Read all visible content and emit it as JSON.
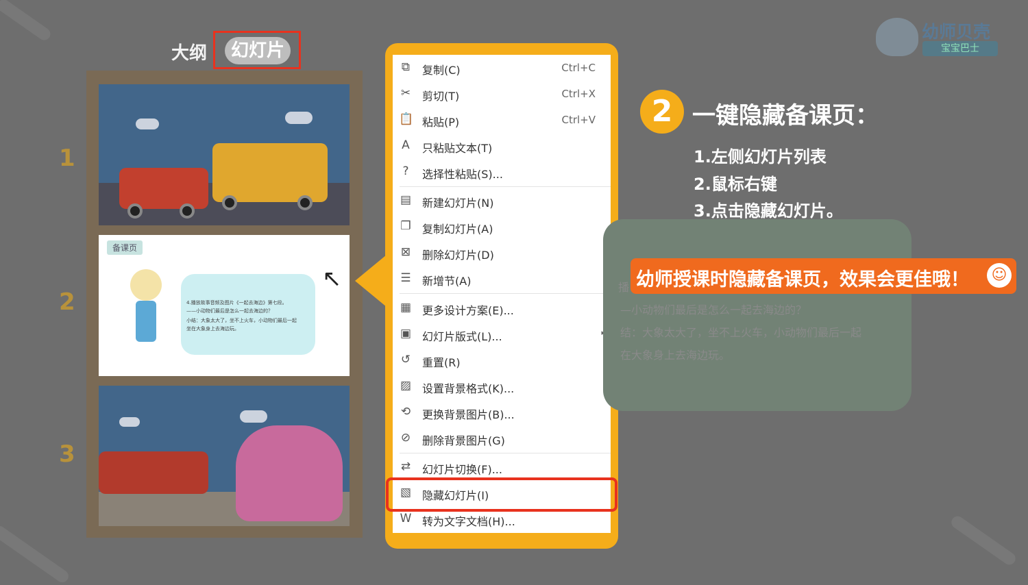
{
  "tabs": {
    "outline": "大纲",
    "slides": "幻灯片"
  },
  "slides": [
    {
      "number": "1"
    },
    {
      "number": "2",
      "badge": "备课页",
      "text_lines": [
        "4.播放故事音频及图片《一起去海边》第七段。",
        "——小动物们最后是怎么一起去海边的？",
        "小结：大象太大了，坐不上火车，小动物们最后一起",
        "坐在大象身上去海边玩。"
      ]
    },
    {
      "number": "3"
    }
  ],
  "context_menu": {
    "items": [
      {
        "icon": "copy-icon",
        "label": "复制(C)",
        "shortcut": "Ctrl+C"
      },
      {
        "icon": "scissors-icon",
        "label": "剪切(T)",
        "shortcut": "Ctrl+X"
      },
      {
        "icon": "clipboard-icon",
        "label": "粘贴(P)",
        "shortcut": "Ctrl+V"
      },
      {
        "icon": "paste-text-icon",
        "label": "只粘贴文本(T)",
        "shortcut": ""
      },
      {
        "icon": "paste-special-icon",
        "label": "选择性粘贴(S)...",
        "shortcut": ""
      },
      {
        "icon": "new-slide-icon",
        "label": "新建幻灯片(N)",
        "shortcut": ""
      },
      {
        "icon": "duplicate-slide-icon",
        "label": "复制幻灯片(A)",
        "shortcut": ""
      },
      {
        "icon": "delete-slide-icon",
        "label": "删除幻灯片(D)",
        "shortcut": ""
      },
      {
        "icon": "new-section-icon",
        "label": "新增节(A)",
        "shortcut": ""
      },
      {
        "icon": "design-icon",
        "label": "更多设计方案(E)...",
        "shortcut": ""
      },
      {
        "icon": "layout-icon",
        "label": "幻灯片版式(L)...",
        "shortcut": "",
        "submenu": "▸"
      },
      {
        "icon": "reset-icon",
        "label": "重置(R)",
        "shortcut": ""
      },
      {
        "icon": "background-format-icon",
        "label": "设置背景格式(K)...",
        "shortcut": ""
      },
      {
        "icon": "change-background-icon",
        "label": "更换背景图片(B)...",
        "shortcut": ""
      },
      {
        "icon": "delete-background-icon",
        "label": "删除背景图片(G)",
        "shortcut": ""
      },
      {
        "icon": "transition-icon",
        "label": "幻灯片切换(F)...",
        "shortcut": ""
      },
      {
        "icon": "hide-slide-icon",
        "label": "隐藏幻灯片(I)",
        "shortcut": ""
      },
      {
        "icon": "word-doc-icon",
        "label": "转为文字文档(H)...",
        "shortcut": ""
      }
    ]
  },
  "instructions": {
    "step_number": "2",
    "title": "一键隐藏备课页：",
    "steps": [
      "1.左侧幻灯片列表",
      "2.鼠标右键",
      "3.点击隐藏幻灯片。"
    ]
  },
  "background_text": {
    "line1": "—小动物们最后是怎么一起去海边的？",
    "line2": "结：大象太大了，坐不上火车，小动物们最后一起",
    "line3": "在大象身上去海边玩。",
    "fragment": "播"
  },
  "tip": {
    "text": "幼师授课时隐藏备课页，效果会更佳哦！"
  },
  "logo": {
    "name": "幼师贝壳",
    "subtitle": "宝宝巴士"
  },
  "colors": {
    "accent": "#f5ad1a",
    "highlight": "#e8321e",
    "tip": "#f06a1e"
  }
}
